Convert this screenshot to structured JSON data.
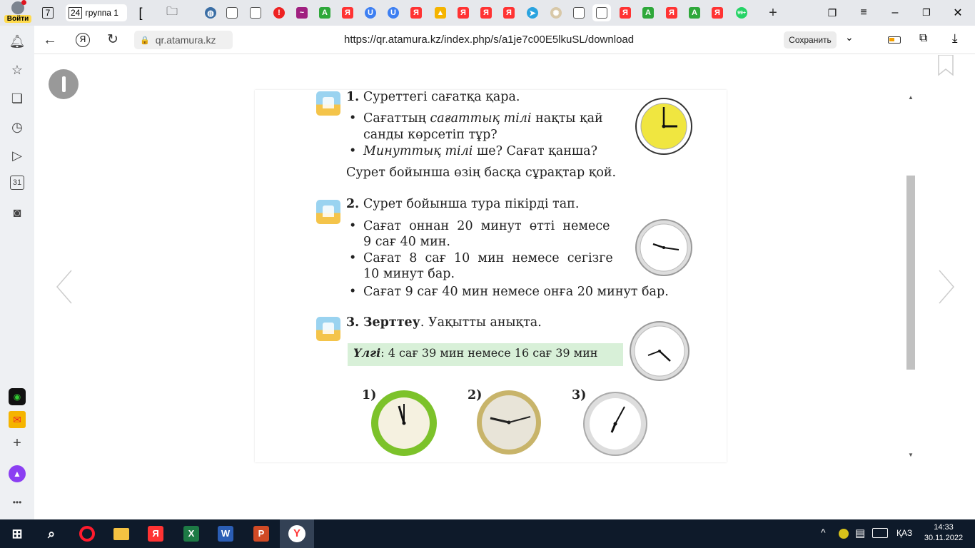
{
  "browser": {
    "login_label": "Войти",
    "tab_count": "7",
    "group_count": "24",
    "group_label": "группа 1",
    "domain_chip": "qr.atamura.kz",
    "url": "https://qr.atamura.kz/index.php/s/a1je7c00E5lkuSL/download",
    "save_label": "Сохранить"
  },
  "lesson": {
    "task1": {
      "number": "1.",
      "title": "Суреттегі сағатқа қара.",
      "line1_a": "Сағаттың ",
      "line1_em": "сағаттық тілі",
      "line1_b": " нақты қай",
      "line2": "санды көрсетіп тұр?",
      "line3_em": "Минуттық тілі",
      "line3_b": " ше? Сағат қанша?",
      "line4": "Сурет бойынша өзің басқа сұрақтар қой."
    },
    "task2": {
      "number": "2.",
      "title": "Сурет бойынша тура пікірді тап.",
      "b1_l1": "Сағат  оннан  20  минут  өтті  немесе",
      "b1_l2": "9 сағ 40 мин.",
      "b2_l1": "Сағат  8  сағ  10  мин  немесе  сегізге",
      "b2_l2": "10 минут бар.",
      "b3": "Сағат 9 сағ 40 мин немесе онға 20 минут бар."
    },
    "task3": {
      "number": "3.",
      "title_bold": "Зерттеу",
      "title_rest": ". Уақытты анықта.",
      "sample_em": "Үлгі",
      "sample_rest": ": 4 сағ 39 мин немесе 16 сағ 39 мин",
      "clock_labels": [
        "1)",
        "2)",
        "3)"
      ]
    }
  },
  "taskbar": {
    "time": "14:33",
    "date": "30.11.2022",
    "lang": "ҚАЗ"
  },
  "colors": {
    "tab_bar": "#e6e8ec",
    "sidebar": "#eef0f3",
    "taskbar": "#0e1a2a",
    "yandex_red": "#f33",
    "sample_bg": "#d8f0d8"
  }
}
